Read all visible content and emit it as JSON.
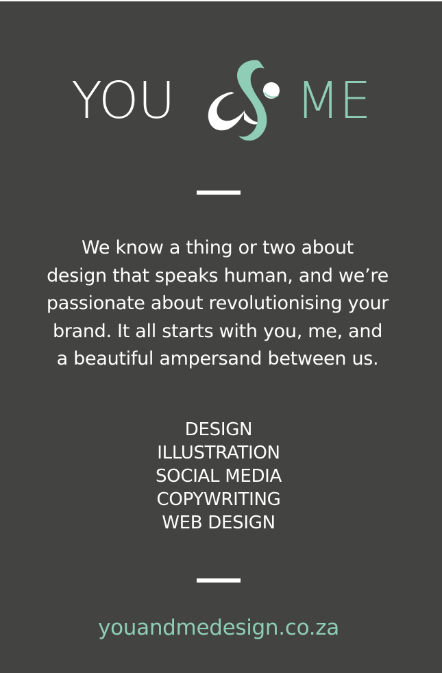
{
  "colors": {
    "background": "#434442",
    "text": "#ffffff",
    "accent": "#8fcdb6"
  },
  "logo": {
    "word_left": "YOU",
    "ampersand": "&",
    "word_right": "ME"
  },
  "intro": {
    "lines": [
      "We know a thing or two about",
      "design that speaks human, and we’re",
      "passionate about revolutionising your",
      "brand. It all starts with you, me, and",
      "a beautiful ampersand between us."
    ]
  },
  "services": {
    "items": [
      "DESIGN",
      "ILLUSTRATION",
      "SOCIAL MEDIA",
      "COPYWRITING",
      "WEB DESIGN"
    ]
  },
  "website": {
    "url": "youandmedesign.co.za"
  }
}
